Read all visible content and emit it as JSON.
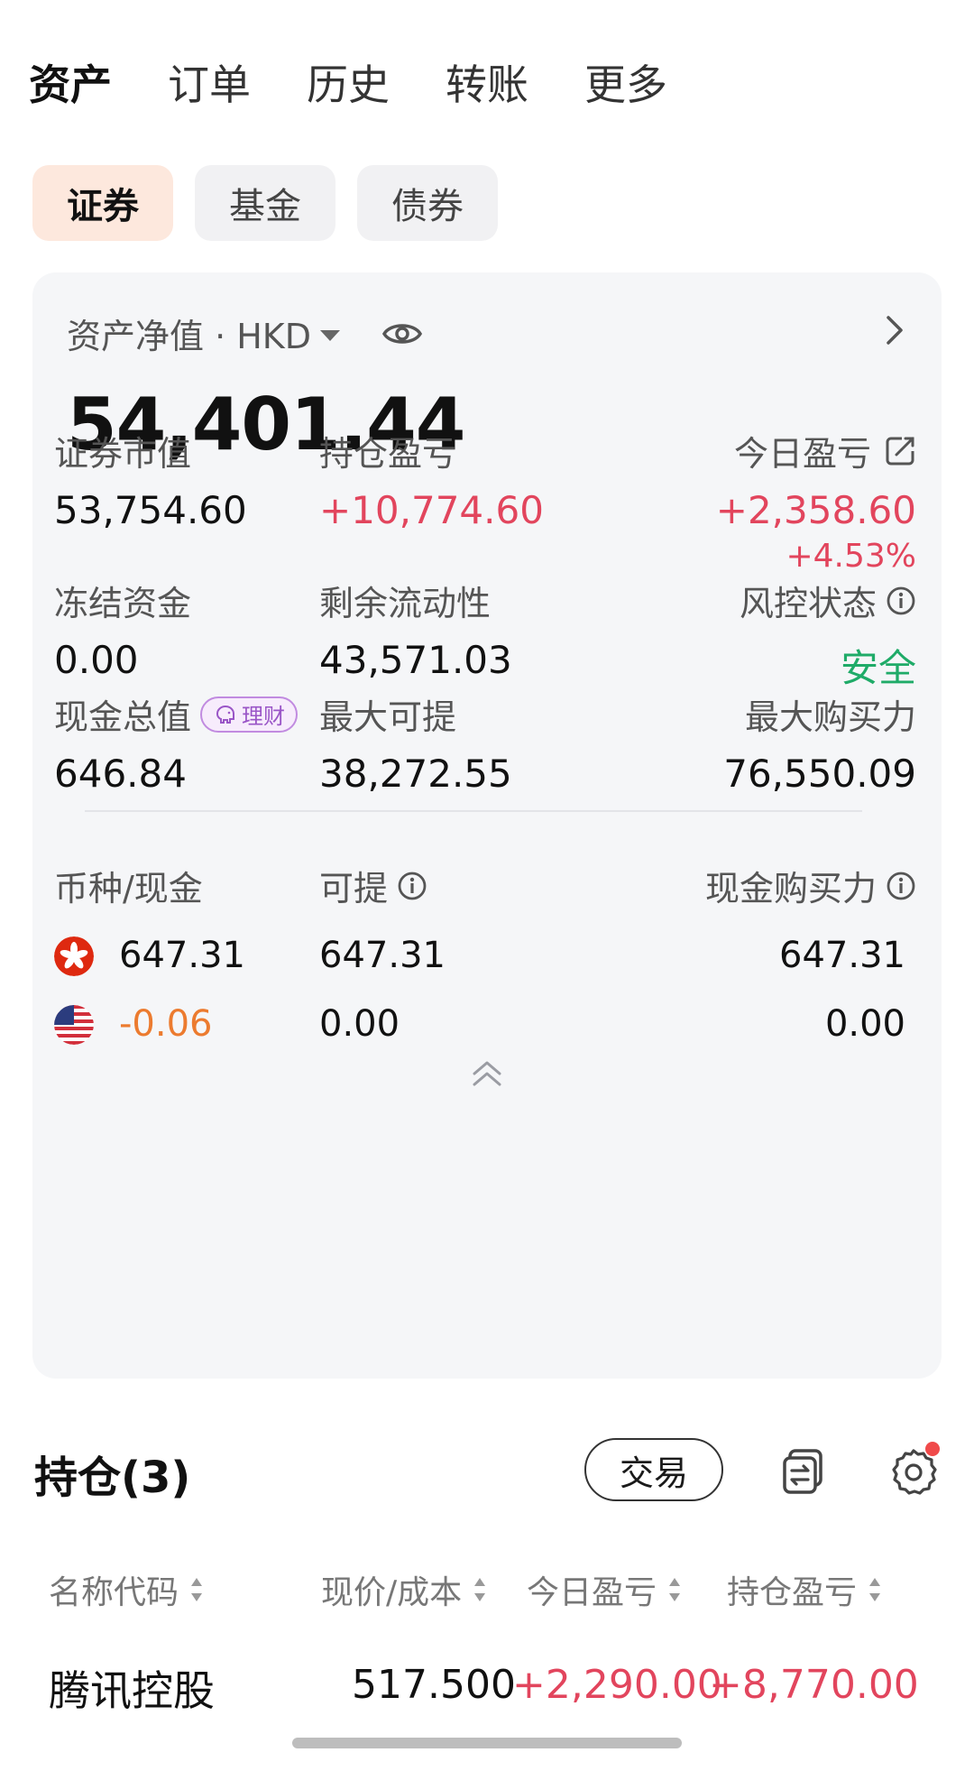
{
  "top_tabs": [
    "资产",
    "订单",
    "历史",
    "转账",
    "更多"
  ],
  "sub_tabs": [
    "证券",
    "基金",
    "债券"
  ],
  "asset_card": {
    "net_label": "资产净值 · HKD",
    "net_value": "54,401.44",
    "metrics": {
      "securities_value": {
        "label": "证券市值",
        "value": "53,754.60"
      },
      "holding_pnl": {
        "label": "持仓盈亏",
        "value": "+10,774.60"
      },
      "today_pnl": {
        "label": "今日盈亏",
        "value": "+2,358.60",
        "pct": "+4.53%"
      },
      "frozen_funds": {
        "label": "冻结资金",
        "value": "0.00"
      },
      "remaining_liquidity": {
        "label": "剩余流动性",
        "value": "43,571.03"
      },
      "risk_status": {
        "label": "风控状态",
        "value": "安全"
      },
      "cash_total": {
        "label": "现金总值",
        "badge": "理财",
        "value": "646.84"
      },
      "max_withdraw": {
        "label": "最大可提",
        "value": "38,272.55"
      },
      "max_buying_power": {
        "label": "最大购买力",
        "value": "76,550.09"
      }
    },
    "currency_table": {
      "headers": [
        "币种/现金",
        "可提",
        "现金购买力"
      ],
      "rows": [
        {
          "flag": "hk-flag-icon",
          "cash": "647.31",
          "withdrawable": "647.31",
          "buying_power": "647.31"
        },
        {
          "flag": "us-flag-icon",
          "cash": "-0.06",
          "withdrawable": "0.00",
          "buying_power": "0.00"
        }
      ]
    }
  },
  "holdings": {
    "title": "持仓(3)",
    "trade_button": "交易",
    "columns": [
      "名称代码",
      "现价/成本",
      "今日盈亏",
      "持仓盈亏"
    ],
    "rows": [
      {
        "name": "腾讯控股",
        "price": "517.500",
        "today_pnl": "+2,290.00",
        "holding_pnl": "+8,770.00"
      }
    ]
  },
  "colors": {
    "up_red": "#e2455d",
    "safe_green": "#1fab68",
    "negative_orange": "#ec7b2f",
    "accent_orange": "#f39a5b"
  }
}
